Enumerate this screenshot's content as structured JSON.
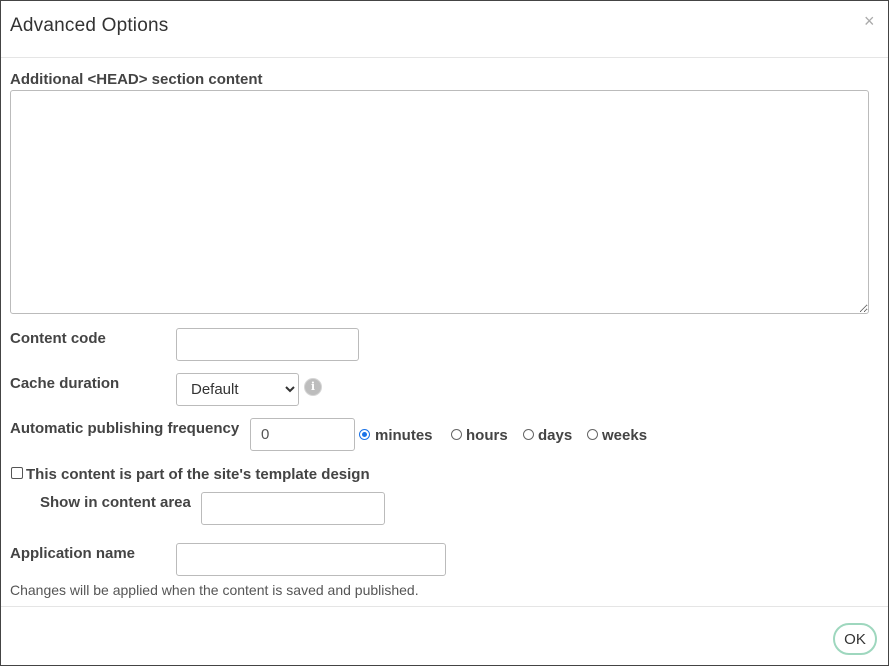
{
  "dialog": {
    "title": "Advanced Options",
    "close_symbol": "×"
  },
  "head_section": {
    "label": "Additional <HEAD> section content",
    "value": ""
  },
  "content_code": {
    "label": "Content code",
    "value": ""
  },
  "cache_duration": {
    "label": "Cache duration",
    "selected": "Default",
    "info_icon": "info-icon"
  },
  "publishing": {
    "label": "Automatic publishing frequency",
    "value": "0",
    "units": [
      {
        "label": "minutes",
        "checked": true
      },
      {
        "label": "hours",
        "checked": false
      },
      {
        "label": "days",
        "checked": false
      },
      {
        "label": "weeks",
        "checked": false
      }
    ]
  },
  "template_design": {
    "label": "This content is part of the site's template design",
    "checked": false
  },
  "content_area": {
    "label": "Show in content area",
    "value": ""
  },
  "application": {
    "label": "Application name",
    "value": ""
  },
  "note": "Changes will be applied when the content is saved and published.",
  "footer": {
    "ok_label": "OK"
  }
}
